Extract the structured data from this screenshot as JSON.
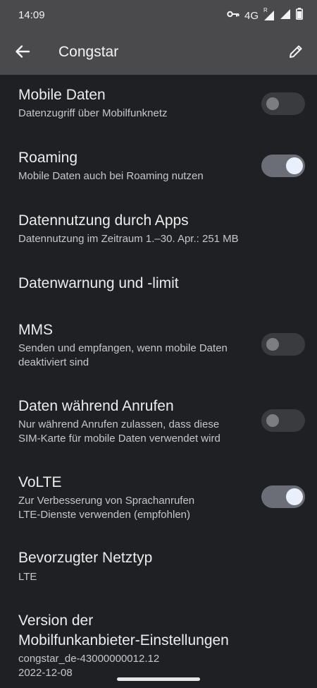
{
  "status": {
    "time": "14:09",
    "network": "4G",
    "roaming_mark": "R"
  },
  "header": {
    "title": "Congstar"
  },
  "icons": {
    "back": "arrow-back-icon",
    "edit": "pencil-icon",
    "vpn": "key-icon",
    "signal": "signal-icon",
    "battery": "battery-icon"
  },
  "items": [
    {
      "title": "Mobile Daten",
      "sub": "Datenzugriff über Mobilfunknetz",
      "toggle": false
    },
    {
      "title": "Roaming",
      "sub": "Mobile Daten auch bei Roaming nutzen",
      "toggle": true
    },
    {
      "title": "Datennutzung durch Apps",
      "sub": "Datennutzung im Zeitraum 1.–30. Apr.: 251 MB"
    },
    {
      "title": "Datenwarnung und -limit"
    },
    {
      "title": "MMS",
      "sub1": "Senden und empfangen, wenn mobile Daten",
      "sub2": "deaktiviert sind",
      "toggle": false
    },
    {
      "title": "Daten während Anrufen",
      "sub1": "Nur während Anrufen zulassen, dass diese",
      "sub2": "SIM-Karte für mobile Daten verwendet wird",
      "toggle": false
    },
    {
      "title": "VoLTE",
      "sub1": "Zur Verbesserung von Sprachanrufen",
      "sub2": "LTE-Dienste verwenden (empfohlen)",
      "toggle": true
    },
    {
      "title": "Bevorzugter Netztyp",
      "sub": "LTE"
    },
    {
      "title1": "Version der",
      "title2": "Mobilfunkanbieter-Einstellungen",
      "sub1": "congstar_de-43000000012.12",
      "sub2": "2022-12-08"
    }
  ],
  "colors": {
    "background": "#1f2023",
    "appbar": "#4a4a4c",
    "toggle_on": "#6b6e76",
    "toggle_off": "#3a3b3f"
  }
}
